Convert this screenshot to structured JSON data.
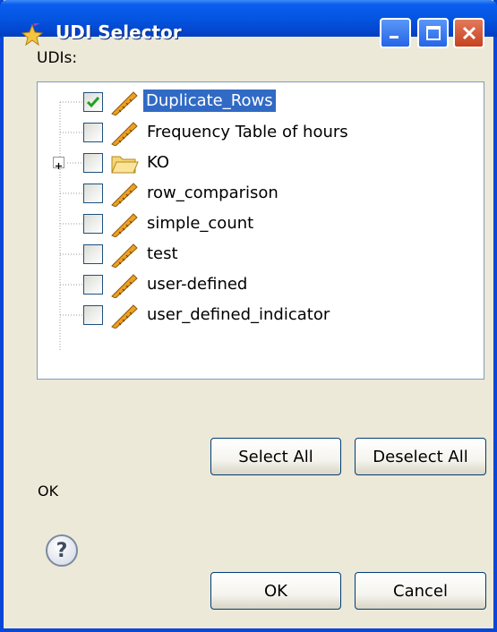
{
  "window": {
    "title": "UDI Selector"
  },
  "titlebar": {
    "minimize_icon": "minimize-icon",
    "maximize_icon": "maximize-icon",
    "close_icon": "close-icon"
  },
  "udis_label": "UDIs:",
  "tree": {
    "items": [
      {
        "label": "Duplicate_Rows",
        "checked": true,
        "selected": true,
        "icon": "ruler-pencil-icon"
      },
      {
        "label": "Frequency Table of hours",
        "checked": false,
        "selected": false,
        "icon": "ruler-pencil-icon"
      },
      {
        "label": "KO",
        "checked": false,
        "selected": false,
        "icon": "folder-icon",
        "expandable": true
      },
      {
        "label": "row_comparison",
        "checked": false,
        "selected": false,
        "icon": "ruler-pencil-icon"
      },
      {
        "label": "simple_count",
        "checked": false,
        "selected": false,
        "icon": "ruler-pencil-icon"
      },
      {
        "label": "test",
        "checked": false,
        "selected": false,
        "icon": "ruler-pencil-icon"
      },
      {
        "label": "user-defined",
        "checked": false,
        "selected": false,
        "icon": "ruler-pencil-icon"
      },
      {
        "label": "user_defined_indicator",
        "checked": false,
        "selected": false,
        "icon": "ruler-pencil-icon"
      }
    ]
  },
  "buttons": {
    "select_all": "Select All",
    "deselect_all": "Deselect All",
    "ok": "OK",
    "cancel": "Cancel"
  },
  "status_text": "OK",
  "colors": {
    "titlebar": "#0455e0",
    "selection": "#316ac5",
    "dialog_bg": "#ece9d8"
  }
}
